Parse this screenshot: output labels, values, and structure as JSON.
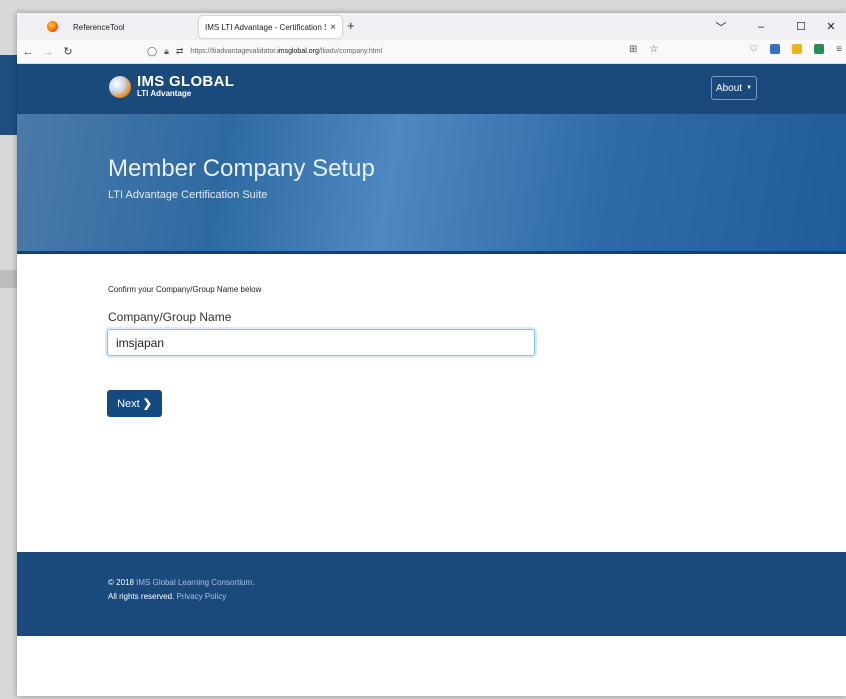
{
  "browser": {
    "tabs": [
      {
        "label": "ReferenceTool",
        "close": "×"
      },
      {
        "label": "IMS LTI Advantage - Certification S…",
        "close": "×"
      }
    ],
    "new_tab": "+",
    "url_prefix": "https://ltiadvantagevalidator.",
    "url_domain": "imsglobal.org",
    "url_path": "/ltiadv/company.html",
    "window_controls": [
      "﹀",
      "–",
      "☐",
      "✕"
    ]
  },
  "site": {
    "logo_main": "IMS GLOBAL",
    "logo_sub": "LTI Advantage",
    "about_label": "About"
  },
  "hero": {
    "title": "Member Company Setup",
    "subtitle": "LTI Advantage Certification Suite"
  },
  "form": {
    "instruction": "Confirm your Company/Group Name below",
    "field_label": "Company/Group Name",
    "field_value": "imsjapan",
    "next_label": "Next"
  },
  "footer": {
    "copyright": "© 2018",
    "org_link": "IMS Global Learning Consortium.",
    "rights": "All rights reserved.",
    "privacy_link": "Privacy Policy"
  },
  "colors": {
    "header_blue": "#1a4a7c",
    "button_blue": "#154a80"
  }
}
